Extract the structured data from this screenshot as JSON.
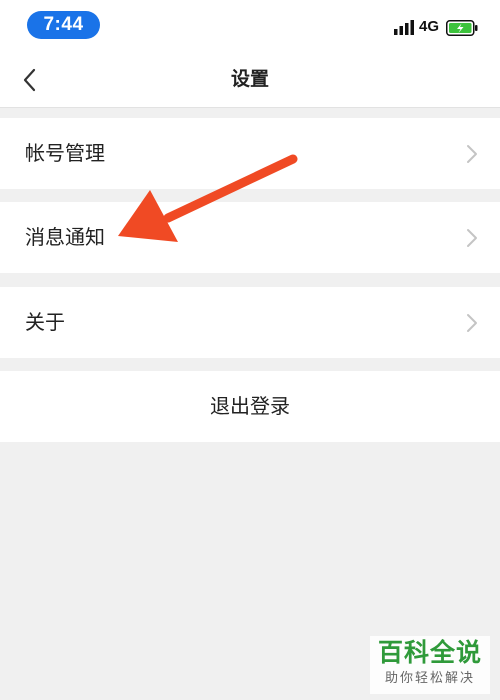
{
  "status_bar": {
    "time": "7:44",
    "network": "4G",
    "icons": [
      "signal-icon",
      "battery-charging-icon"
    ],
    "time_pill_color": "#1a73e8",
    "battery_color": "#3cc23c"
  },
  "nav": {
    "title": "设置",
    "back_icon": "chevron-left-icon"
  },
  "settings": {
    "items": [
      {
        "label": "帐号管理",
        "icon": "chevron-right-icon"
      },
      {
        "label": "消息通知",
        "icon": "chevron-right-icon"
      },
      {
        "label": "关于",
        "icon": "chevron-right-icon"
      }
    ],
    "logout_label": "退出登录"
  },
  "annotation": {
    "icon": "red-arrow-pointing-left",
    "color": "#f04a24"
  },
  "watermark": {
    "title": "百科全说",
    "subtitle": "助你轻松解决",
    "color": "#2f9a3a"
  }
}
